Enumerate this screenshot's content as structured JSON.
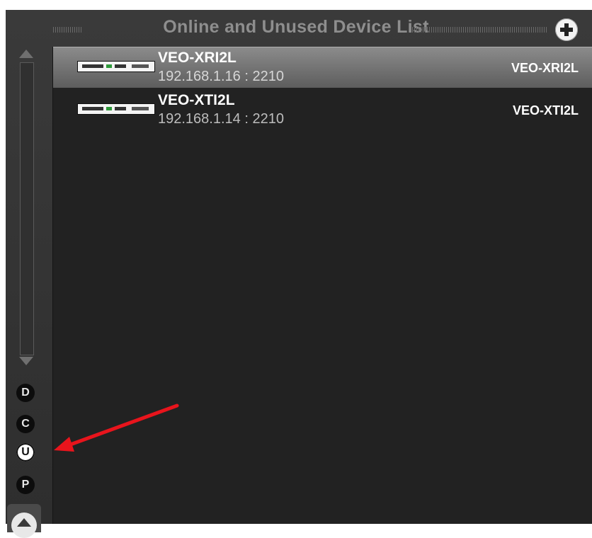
{
  "header": {
    "title": "Online and Unused Device List"
  },
  "rail": {
    "buttons": [
      {
        "label": "D",
        "active": false
      },
      {
        "label": "C",
        "active": false
      },
      {
        "label": "U",
        "active": true
      },
      {
        "label": "P",
        "active": false
      }
    ]
  },
  "devices": [
    {
      "name": "VEO-XRI2L",
      "address": "192.168.1.16 : 2210",
      "model": "VEO-XRI2L",
      "selected": true
    },
    {
      "name": "VEO-XTI2L",
      "address": "192.168.1.14 : 2210",
      "model": "VEO-XTI2L",
      "selected": false
    }
  ],
  "colors": {
    "panel_bg": "#2e2e2e",
    "list_bg": "#222222",
    "selected_row": "#7a7a7a",
    "annotation_arrow": "#e8141c"
  },
  "icons": {
    "add": "plus-circle-icon",
    "scroll_up": "triangle-up-icon",
    "scroll_down": "triangle-down-icon",
    "device": "rack-unit-device-icon"
  }
}
